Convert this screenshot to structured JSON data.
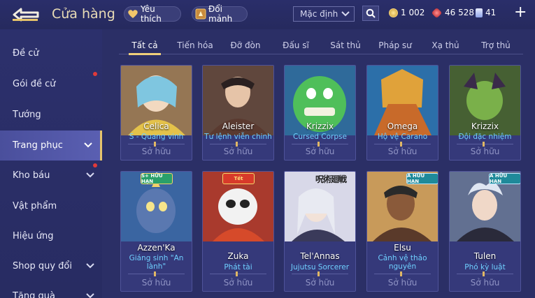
{
  "header": {
    "title": "Cửa hàng",
    "favorites_label": "Yêu thích",
    "shards_label": "Đổi mảnh",
    "sort_value": "Mặc định",
    "gold": "1 002",
    "rubies": "46 528",
    "vouchers": "41",
    "plus": "+"
  },
  "sidebar": {
    "items": [
      {
        "label": "Đề cử"
      },
      {
        "label": "Gói đề cử"
      },
      {
        "label": "Tướng"
      },
      {
        "label": "Trang phục"
      },
      {
        "label": "Kho báu"
      },
      {
        "label": "Vật phẩm"
      },
      {
        "label": "Hiệu ứng"
      },
      {
        "label": "Shop quy đổi"
      },
      {
        "label": "Tặng quà"
      }
    ]
  },
  "tabs": [
    "Tất cả",
    "Tiến hóa",
    "Đỡ đòn",
    "Đấu sĩ",
    "Sát thủ",
    "Pháp sư",
    "Xạ thủ",
    "Trợ thủ"
  ],
  "cards": [
    {
      "hero": "Celica",
      "skin": "S - Quang vinh",
      "status": "Sở hữu",
      "color": "#d4a842"
    },
    {
      "hero": "Aleister",
      "skin": "Tư lệnh viễn chinh",
      "status": "Sở hữu",
      "color": "#7a5a4a"
    },
    {
      "hero": "Krizzix",
      "skin": "Cursed Corpse",
      "status": "Sở hữu",
      "color": "#4fbf5a"
    },
    {
      "hero": "Omega",
      "skin": "Hộ vệ Carano",
      "status": "Sở hữu",
      "color": "#3a8fc8"
    },
    {
      "hero": "Krizzix",
      "skin": "Đội đặc nhiệm",
      "status": "Sở hữu",
      "color": "#5a7a3a"
    },
    {
      "hero": "Azzen'Ka",
      "skin": "Giáng sinh \"An lành\"",
      "status": "Sở hữu",
      "color": "#4a7fc8",
      "badge": "S+ HỮU HẠN"
    },
    {
      "hero": "Zuka",
      "skin": "Phát tài",
      "status": "Sở hữu",
      "color": "#c8492f",
      "badge": "Tết"
    },
    {
      "hero": "Tel'Annas",
      "skin": "Jujutsu Sorcerer",
      "status": "Sở hữu",
      "color": "#8a8fb8",
      "banner": "呪術廻戦"
    },
    {
      "hero": "Elsu",
      "skin": "Cảnh vệ thảo nguyên",
      "status": "Sở hữu",
      "color": "#a87a3a",
      "badge": "A HỮU HẠN"
    },
    {
      "hero": "Tulen",
      "skin": "Phó kỳ luật",
      "status": "Sở hữu",
      "color": "#7a86a8",
      "badge": "A HỮU HẠN"
    }
  ],
  "colors": {
    "accent": "#f0d07a",
    "skin_text": "#6fd0ff",
    "owned_text": "#8f93c4"
  }
}
